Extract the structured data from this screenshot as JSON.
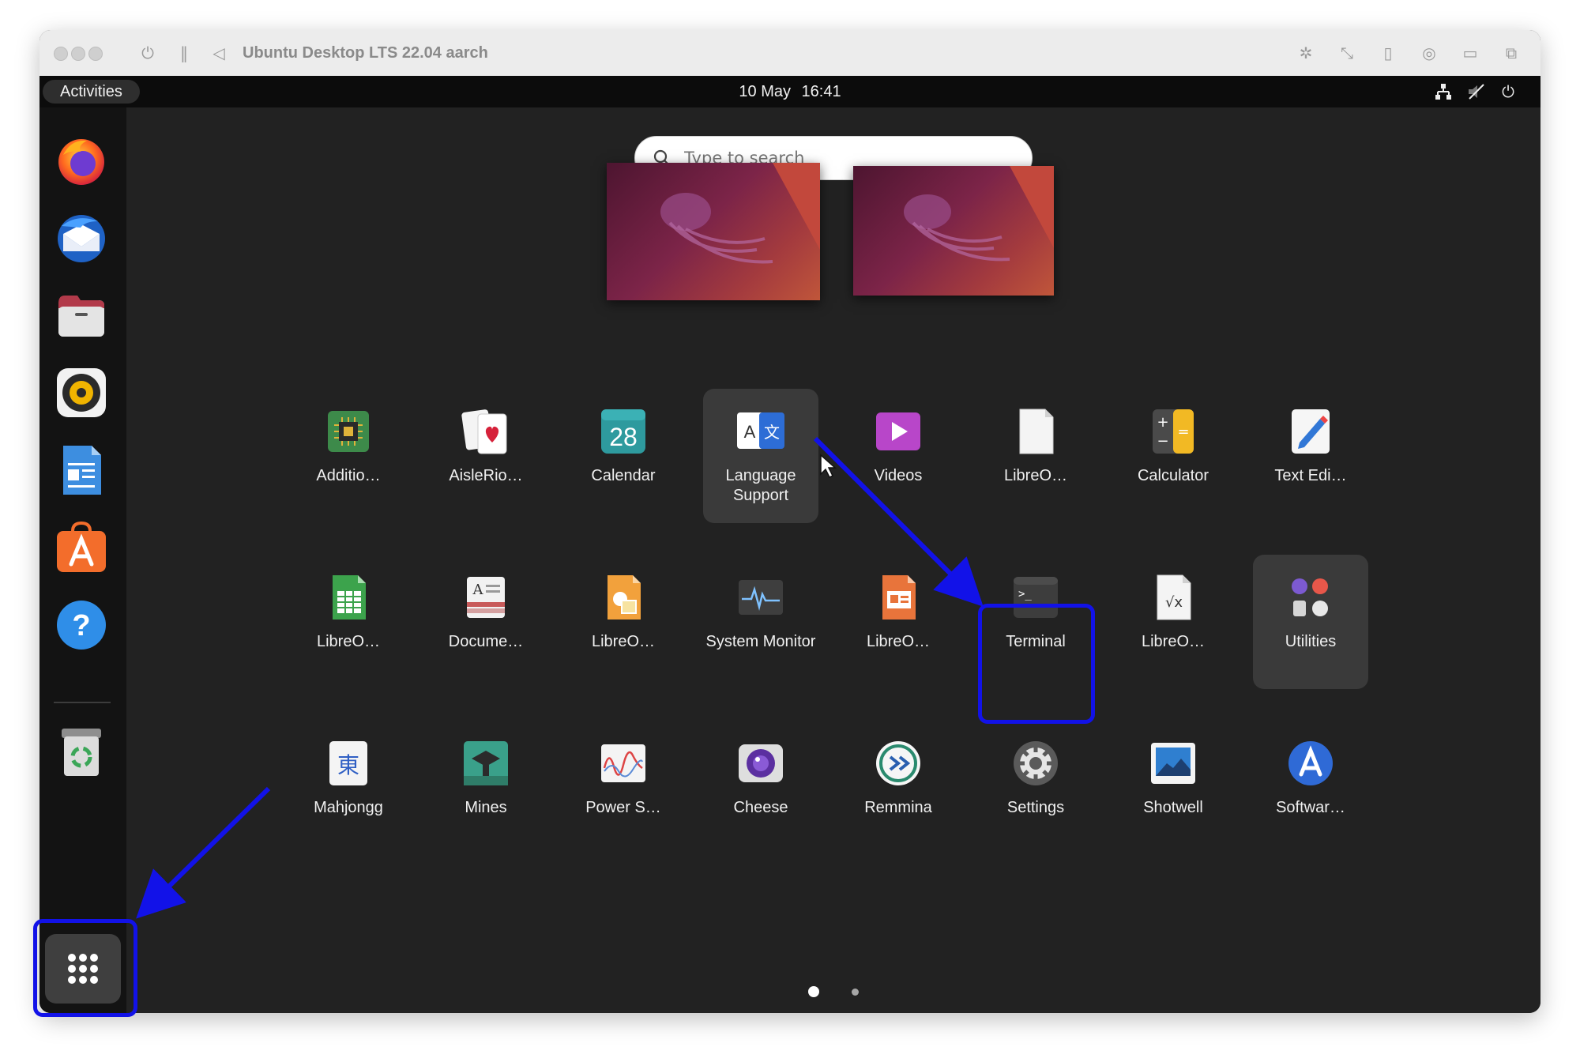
{
  "window": {
    "title": "Ubuntu Desktop LTS 22.04 aarch",
    "toolbar_icons": [
      "power-icon",
      "pause-icon",
      "back-icon",
      "brightness-icon",
      "resize-icon",
      "usb-icon",
      "camera-icon",
      "folder-icon",
      "window-icon"
    ]
  },
  "topbar": {
    "activities_label": "Activities",
    "date": "10 May",
    "time": "16:41",
    "status_icons": [
      "network-icon",
      "volume-muted-icon",
      "power-icon"
    ]
  },
  "search": {
    "placeholder": "Type to search"
  },
  "dock": {
    "items": [
      "firefox-icon",
      "thunderbird-icon",
      "files-icon",
      "rhythmbox-icon",
      "writer-icon",
      "app-center-icon",
      "help-icon",
      "trash-icon"
    ],
    "show_apps_icon": "grid-icon"
  },
  "apps": {
    "row1": [
      {
        "label": "Additio…",
        "icon": "chip-icon"
      },
      {
        "label": "AisleRio…",
        "icon": "cards-icon"
      },
      {
        "label": "Calendar",
        "icon": "calendar-icon",
        "day": "28"
      },
      {
        "label": "Language Support",
        "icon": "language-icon"
      },
      {
        "label": "Videos",
        "icon": "videos-icon"
      },
      {
        "label": "LibreO…",
        "icon": "document-icon"
      },
      {
        "label": "Calculator",
        "icon": "calculator-icon"
      },
      {
        "label": "Text Edi…",
        "icon": "text-editor-icon"
      }
    ],
    "row2": [
      {
        "label": "LibreO…",
        "icon": "calc-sheet-icon"
      },
      {
        "label": "Docume…",
        "icon": "document-viewer-icon"
      },
      {
        "label": "LibreO…",
        "icon": "draw-icon"
      },
      {
        "label": "System Monitor",
        "icon": "system-monitor-icon"
      },
      {
        "label": "LibreO…",
        "icon": "impress-icon"
      },
      {
        "label": "Terminal",
        "icon": "terminal-icon",
        "prompt": ">_"
      },
      {
        "label": "LibreO…",
        "icon": "math-icon"
      },
      {
        "label": "Utilities",
        "icon": "utilities-folder-icon"
      }
    ],
    "row3": [
      {
        "label": "Mahjongg",
        "icon": "mahjongg-icon",
        "glyph": "東"
      },
      {
        "label": "Mines",
        "icon": "mines-icon"
      },
      {
        "label": "Power S…",
        "icon": "power-stats-icon"
      },
      {
        "label": "Cheese",
        "icon": "cheese-icon"
      },
      {
        "label": "Remmina",
        "icon": "remmina-icon"
      },
      {
        "label": "Settings",
        "icon": "settings-icon"
      },
      {
        "label": "Shotwell",
        "icon": "shotwell-icon"
      },
      {
        "label": "Softwar…",
        "icon": "software-icon"
      }
    ]
  },
  "pager": {
    "pages": 2,
    "current": 1
  },
  "annotation_color": "#1212e8"
}
